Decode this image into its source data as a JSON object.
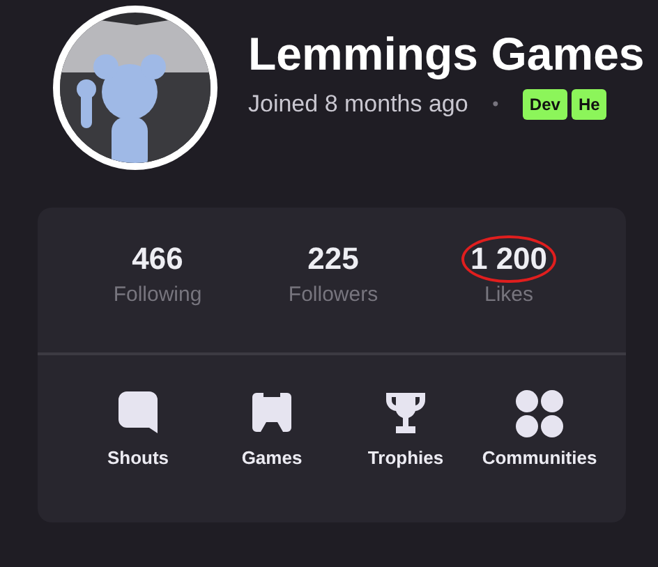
{
  "profile": {
    "name": "Lemmings Games",
    "joined": "Joined 8 months ago",
    "separator": "•",
    "badges": [
      {
        "label": "Dev",
        "color": "#8cf55a"
      },
      {
        "label": "He",
        "color": "#8cf55a"
      }
    ]
  },
  "stats": [
    {
      "value": "466",
      "label": "Following",
      "highlighted": false
    },
    {
      "value": "225",
      "label": "Followers",
      "highlighted": false
    },
    {
      "value": "1 200",
      "label": "Likes",
      "highlighted": true
    }
  ],
  "links": [
    {
      "kind": "shouts",
      "label": "Shouts"
    },
    {
      "kind": "games",
      "label": "Games"
    },
    {
      "kind": "trophies",
      "label": "Trophies"
    },
    {
      "kind": "communities",
      "label": "Communities"
    }
  ]
}
